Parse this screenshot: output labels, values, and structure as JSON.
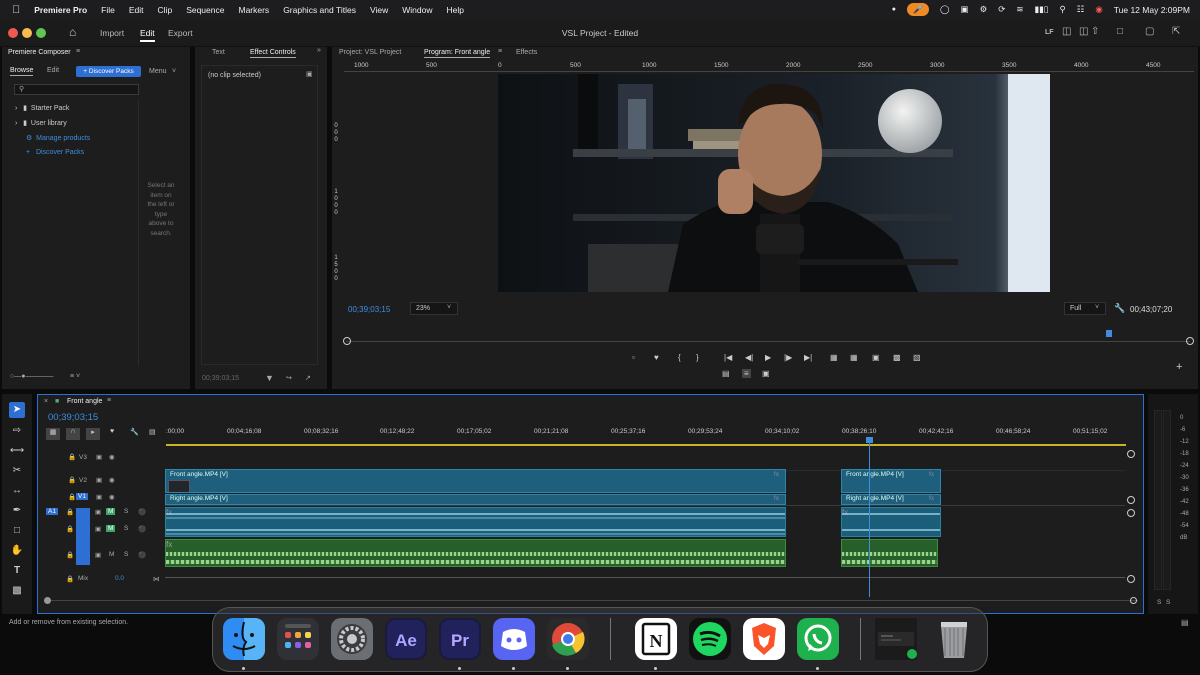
{
  "menubar": {
    "app": "Premiere Pro",
    "items": [
      "File",
      "Edit",
      "Clip",
      "Sequence",
      "Markers",
      "Graphics and Titles",
      "View",
      "Window",
      "Help"
    ],
    "datetime": "Tue 12 May  2:09PM"
  },
  "titlebar": {
    "tabs": [
      "Import",
      "Edit",
      "Export"
    ],
    "active_tab": "Edit",
    "title": "VSL Project - Edited",
    "lf": "LF"
  },
  "left_panel": {
    "title": "Premiere Composer",
    "tabs": [
      "Browse",
      "Edit"
    ],
    "discover_button": "+ Discover Packs",
    "menu": "Menu",
    "tree": [
      "Starter Pack",
      "User library",
      "Manage products",
      "Discover Packs"
    ],
    "hint": "Select an item on the left or type above to search."
  },
  "effect_controls": {
    "tabs": [
      "Text",
      "Effect Controls"
    ],
    "no_clip": "(no clip selected)",
    "timecode": "00;39;03;15"
  },
  "program": {
    "tabs": [
      "Project: VSL Project",
      "Program: Front angle",
      "Effects"
    ],
    "ruler": [
      "1000",
      "500",
      "0",
      "500",
      "1000",
      "1500",
      "2000",
      "2500",
      "3000",
      "3500",
      "4000",
      "4500"
    ],
    "vruler": [
      "0",
      "0",
      "0",
      "1",
      "0",
      "0",
      "0",
      "1",
      "5",
      "0",
      "0"
    ],
    "timecode_in": "00;39;03;15",
    "zoom": "23%",
    "quality": "Full",
    "timecode_out": "00;43;07;20"
  },
  "timeline": {
    "seq_name": "Front angle",
    "timecode": "00;39;03;15",
    "ruler": [
      ":00;00",
      "00;04;16;08",
      "00;08;32;16",
      "00;12;48;22",
      "00;17;05;02",
      "00;21;21;08",
      "00;25;37;16",
      "00;29;53;24",
      "00;34;10;02",
      "00;38;26;10",
      "00;42;42;16",
      "00;46;58;24",
      "00;51;15;02"
    ],
    "video_tracks": [
      "V3",
      "V2",
      "V1"
    ],
    "audio_tracks": [
      "A1",
      "A2",
      "A3"
    ],
    "source_a1": "A1",
    "mix_label": "Mix",
    "mix_value": "0.0",
    "clips": {
      "v2_a": "Front angle.MP4 [V]",
      "v2_b": "Front angle.MP4 [V]",
      "v1_a": "Right angle.MP4 [V]",
      "v1_b": "Right angle.MP4 [V]",
      "fx": "fx"
    }
  },
  "meter": {
    "scale": [
      "0",
      "-6",
      "-12",
      "-18",
      "-24",
      "-30",
      "-36",
      "-42",
      "-48",
      "-54",
      "dB"
    ],
    "solo": [
      "S",
      "S"
    ]
  },
  "status": "Add or remove from existing selection.",
  "dock": {
    "icons": [
      "finder-icon",
      "launchpad-icon",
      "system-settings-icon",
      "after-effects-icon",
      "premiere-icon",
      "discord-icon",
      "chrome-icon",
      "notion-icon",
      "spotify-icon",
      "brave-icon",
      "whatsapp-icon",
      "window-preview-icon",
      "trash-icon"
    ],
    "ae": "Ae",
    "pr": "Pr",
    "notion": "N"
  },
  "colors": {
    "accent": "#2d8ceb",
    "clip": "#1d5f7c",
    "audio_green": "#3d8d3f",
    "playhead": "#3f8de0"
  }
}
